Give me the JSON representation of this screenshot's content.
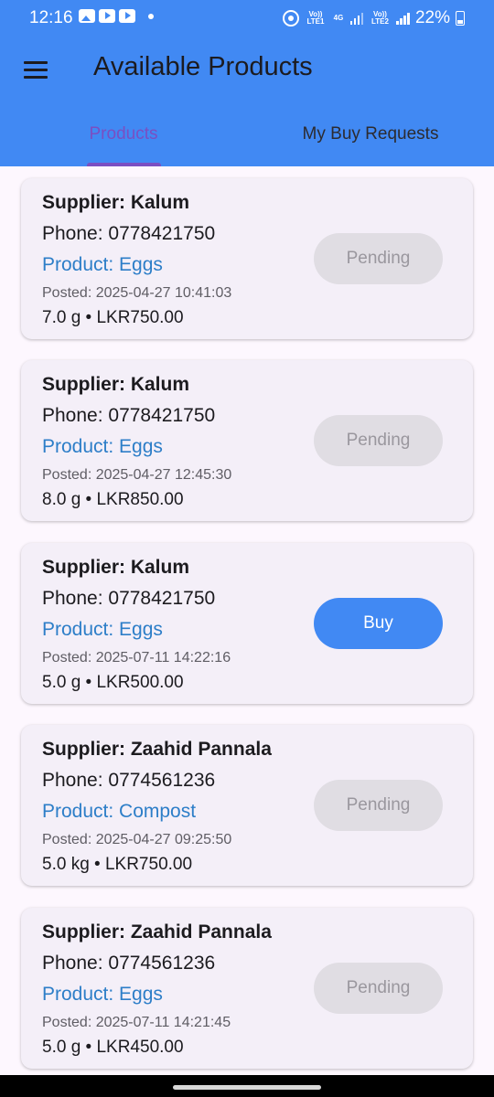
{
  "status_bar": {
    "time": "12:16",
    "sim1_label": "Vo)) LTE1",
    "sim1_net": "4G",
    "sim2_label": "Vo)) LTE2",
    "battery": "22%"
  },
  "app_bar": {
    "title": "Available Products",
    "menu_icon": "hamburger-menu-icon"
  },
  "tabs": [
    {
      "label": "Products",
      "selected": true
    },
    {
      "label": "My Buy Requests",
      "selected": false
    }
  ],
  "products": [
    {
      "supplier": "Supplier: Kalum",
      "phone": "Phone: 0778421750",
      "product": "Product: Eggs",
      "posted": "Posted: 2025-04-27 10:41:03",
      "price": "7.0 g • LKR750.00",
      "action": "Pending",
      "status": "pending"
    },
    {
      "supplier": "Supplier: Kalum",
      "phone": "Phone: 0778421750",
      "product": "Product: Eggs",
      "posted": "Posted: 2025-04-27 12:45:30",
      "price": "8.0 g • LKR850.00",
      "action": "Pending",
      "status": "pending"
    },
    {
      "supplier": "Supplier: Kalum",
      "phone": "Phone: 0778421750",
      "product": "Product: Eggs",
      "posted": "Posted: 2025-07-11 14:22:16",
      "price": "5.0 g • LKR500.00",
      "action": "Buy",
      "status": "buy"
    },
    {
      "supplier": "Supplier: Zaahid Pannala",
      "phone": "Phone: 0774561236",
      "product": "Product: Compost",
      "posted": "Posted: 2025-04-27 09:25:50",
      "price": "5.0 kg • LKR750.00",
      "action": "Pending",
      "status": "pending"
    },
    {
      "supplier": "Supplier: Zaahid Pannala",
      "phone": "Phone: 0774561236",
      "product": "Product: Eggs",
      "posted": "Posted: 2025-07-11 14:21:45",
      "price": "5.0 g • LKR450.00",
      "action": "Pending",
      "status": "pending"
    }
  ],
  "colors": {
    "primary": "#4189f3",
    "tab_selected": "#7a4fc2",
    "product_text": "#2d7ec8",
    "card_bg": "#f4eff8",
    "pending_bg": "#e0dde3"
  }
}
